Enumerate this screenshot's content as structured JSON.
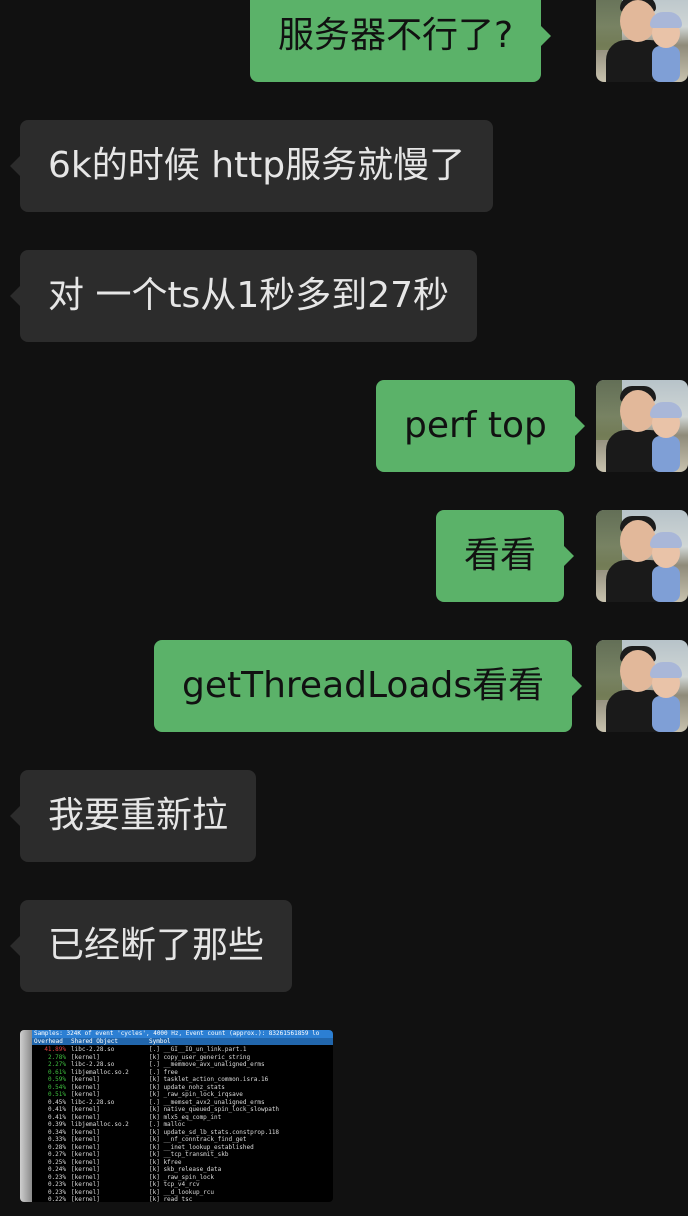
{
  "messages": [
    {
      "side": "out",
      "text": "服务器不行了?"
    },
    {
      "side": "in",
      "text": "6k的时候 http服务就慢了"
    },
    {
      "side": "in",
      "text": "对 一个ts从1秒多到27秒"
    },
    {
      "side": "out",
      "text": "perf top"
    },
    {
      "side": "out",
      "text": "看看"
    },
    {
      "side": "out",
      "text": "getThreadLoads看看"
    },
    {
      "side": "in",
      "text": "我要重新拉"
    },
    {
      "side": "in",
      "text": "已经断了那些"
    }
  ],
  "perf_screenshot": {
    "samples_line": "Samples: 324K of event 'cycles', 4000 Hz, Event count (approx.): 83261561859 lo",
    "header": {
      "overhead": "Overhead",
      "shared_object": "Shared Object",
      "symbol": "Symbol"
    },
    "rows": [
      {
        "overhead": "41.89%",
        "object": "libc-2.28.so",
        "symbol": "[.] __GI__IO_un_link.part.1",
        "color": "#e04040"
      },
      {
        "overhead": "2.78%",
        "object": "[kernel]",
        "symbol": "[k] copy_user_generic_string",
        "color": "#3fbf3f"
      },
      {
        "overhead": "2.27%",
        "object": "libc-2.28.so",
        "symbol": "[.] __memmove_avx_unaligned_erms",
        "color": "#3fbf3f"
      },
      {
        "overhead": "0.61%",
        "object": "libjemalloc.so.2",
        "symbol": "[.] free",
        "color": "#3fbf3f"
      },
      {
        "overhead": "0.59%",
        "object": "[kernel]",
        "symbol": "[k] tasklet_action_common.isra.16",
        "color": "#3fbf3f"
      },
      {
        "overhead": "0.54%",
        "object": "[kernel]",
        "symbol": "[k] update_nohz_stats",
        "color": "#3fbf3f"
      },
      {
        "overhead": "0.51%",
        "object": "[kernel]",
        "symbol": "[k] _raw_spin_lock_irqsave",
        "color": "#3fbf3f"
      },
      {
        "overhead": "0.45%",
        "object": "libc-2.28.so",
        "symbol": "[.] __memset_avx2_unaligned_erms",
        "color": "#dcdcdc"
      },
      {
        "overhead": "0.41%",
        "object": "[kernel]",
        "symbol": "[k] native_queued_spin_lock_slowpath",
        "color": "#dcdcdc"
      },
      {
        "overhead": "0.41%",
        "object": "[kernel]",
        "symbol": "[k] mlx5_eq_comp_int",
        "color": "#dcdcdc"
      },
      {
        "overhead": "0.39%",
        "object": "libjemalloc.so.2",
        "symbol": "[.] malloc",
        "color": "#dcdcdc"
      },
      {
        "overhead": "0.34%",
        "object": "[kernel]",
        "symbol": "[k] update_sd_lb_stats.constprop.118",
        "color": "#dcdcdc"
      },
      {
        "overhead": "0.33%",
        "object": "[kernel]",
        "symbol": "[k] __nf_conntrack_find_get",
        "color": "#dcdcdc"
      },
      {
        "overhead": "0.28%",
        "object": "[kernel]",
        "symbol": "[k] __inet_lookup_established",
        "color": "#dcdcdc"
      },
      {
        "overhead": "0.27%",
        "object": "[kernel]",
        "symbol": "[k] __tcp_transmit_skb",
        "color": "#dcdcdc"
      },
      {
        "overhead": "0.25%",
        "object": "[kernel]",
        "symbol": "[k] kfree",
        "color": "#dcdcdc"
      },
      {
        "overhead": "0.24%",
        "object": "[kernel]",
        "symbol": "[k] skb_release_data",
        "color": "#dcdcdc"
      },
      {
        "overhead": "0.23%",
        "object": "[kernel]",
        "symbol": "[k] _raw_spin_lock",
        "color": "#dcdcdc"
      },
      {
        "overhead": "0.23%",
        "object": "[kernel]",
        "symbol": "[k] tcp_v4_rcv",
        "color": "#dcdcdc"
      },
      {
        "overhead": "0.23%",
        "object": "[kernel]",
        "symbol": "[k] __d_lookup_rcu",
        "color": "#dcdcdc"
      },
      {
        "overhead": "0.22%",
        "object": "[kernel]",
        "symbol": "[k] read_tsc",
        "color": "#dcdcdc"
      }
    ]
  },
  "colors": {
    "background": "#111111",
    "incoming_bubble": "#2c2c2c",
    "outgoing_bubble": "#5bb269"
  }
}
